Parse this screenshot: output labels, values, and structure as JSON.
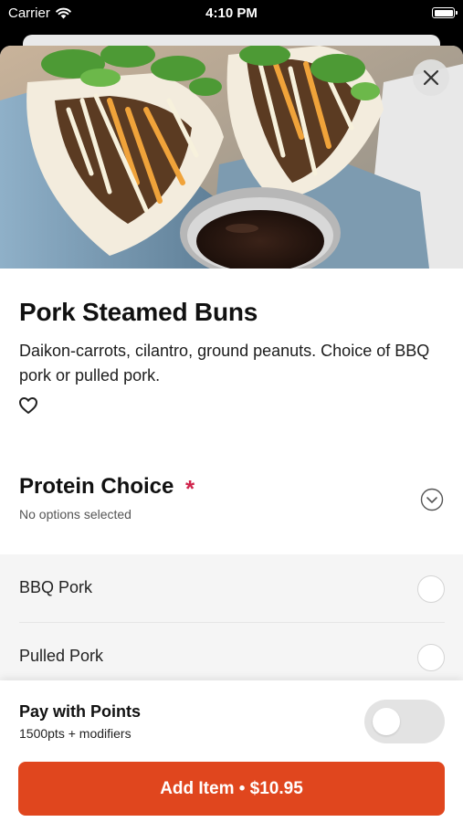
{
  "status_bar": {
    "carrier": "Carrier",
    "time": "4:10 PM"
  },
  "item": {
    "title": "Pork Steamed Buns",
    "description": "Daikon-carrots, cilantro, ground peanuts. Choice of BBQ pork or pulled pork.",
    "hero_icon": "steamed-buns-photo"
  },
  "option_group": {
    "title": "Protein Choice",
    "required_mark": "*",
    "status": "No options selected",
    "options": [
      {
        "label": "BBQ Pork",
        "selected": false
      },
      {
        "label": "Pulled Pork",
        "selected": false
      }
    ]
  },
  "points": {
    "title": "Pay with Points",
    "subtitle": "1500pts + modifiers",
    "enabled": false
  },
  "add_button": {
    "label": "Add Item • $10.95"
  },
  "colors": {
    "accent": "#e0461e",
    "required": "#d0234b"
  }
}
